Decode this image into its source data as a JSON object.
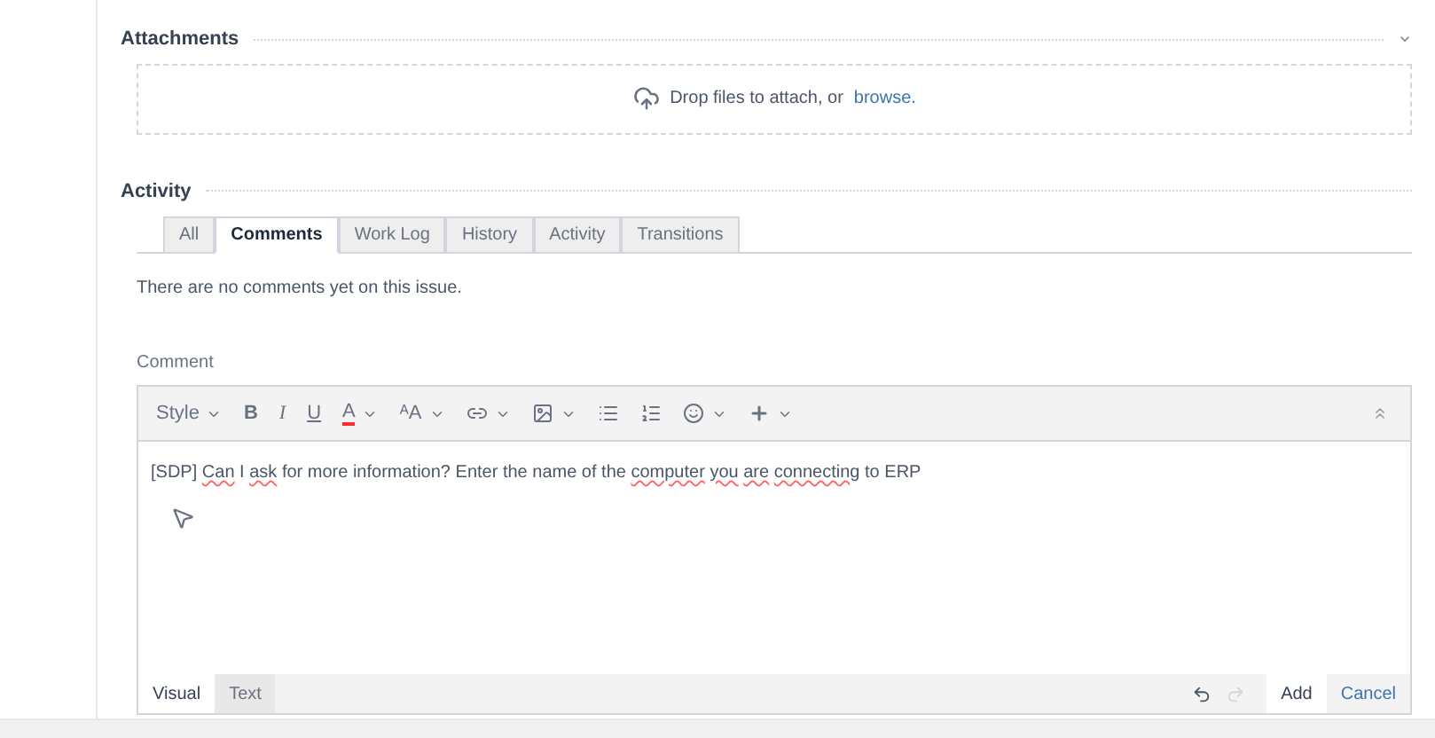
{
  "attachments": {
    "title": "Attachments",
    "drop_text": "Drop files to attach, or",
    "browse_link": "browse."
  },
  "activity": {
    "title": "Activity",
    "tabs": [
      {
        "label": "All",
        "selected": false
      },
      {
        "label": "Comments",
        "selected": true
      },
      {
        "label": "Work Log",
        "selected": false
      },
      {
        "label": "History",
        "selected": false
      },
      {
        "label": "Activity",
        "selected": false
      },
      {
        "label": "Transitions",
        "selected": false
      }
    ],
    "empty_message": "There are no comments yet on this issue."
  },
  "comment": {
    "label": "Comment",
    "toolbar": [
      {
        "kind": "dropdown",
        "label": "Style"
      },
      {
        "kind": "bold",
        "label": "B"
      },
      {
        "kind": "italic",
        "label": "I"
      },
      {
        "kind": "underline",
        "label": "U"
      },
      {
        "kind": "color",
        "label": "A"
      },
      {
        "kind": "size",
        "label": "ᴬA"
      },
      {
        "kind": "link"
      },
      {
        "kind": "image"
      },
      {
        "kind": "bullets"
      },
      {
        "kind": "numbers"
      },
      {
        "kind": "emoji"
      },
      {
        "kind": "plus"
      }
    ],
    "text": [
      {
        "t": "[SDP] ",
        "misspelled": false
      },
      {
        "t": "Can",
        "misspelled": true
      },
      {
        "t": " I ",
        "misspelled": false
      },
      {
        "t": "ask",
        "misspelled": true
      },
      {
        "t": " for more information? Enter the name of the ",
        "misspelled": false
      },
      {
        "t": "computer",
        "misspelled": true
      },
      {
        "t": "you",
        "misspelled": true
      },
      {
        "t": "are",
        "misspelled": true
      },
      {
        "t": "connecting",
        "misspelled": true
      },
      {
        "t": " to ERP",
        "misspelled": false
      }
    ],
    "modes": [
      {
        "label": "Visual",
        "selected": true
      },
      {
        "label": "Text",
        "selected": false
      }
    ],
    "add_button": "Add",
    "cancel_link": "Cancel"
  }
}
